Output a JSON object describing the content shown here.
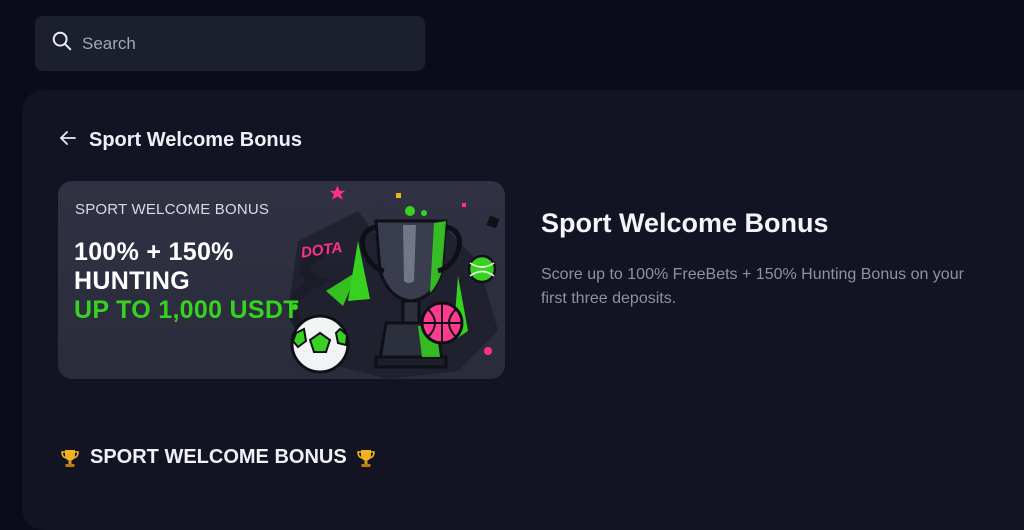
{
  "search": {
    "placeholder": "Search",
    "value": "",
    "icon": "search-icon"
  },
  "header": {
    "back_icon": "arrow-left-icon",
    "title": "Sport Welcome Bonus"
  },
  "banner": {
    "eyebrow": "SPORT WELCOME BONUS",
    "line1": "100% + 150%",
    "line2": "HUNTING",
    "line3": "UP TO 1,000 USDT",
    "sticker": "DOTA",
    "accent": "#36d21f"
  },
  "promo": {
    "title": "Sport Welcome Bonus",
    "description": "Score up to 100% FreeBets + 150% Hunting Bonus on your first three deposits."
  },
  "section": {
    "title": "SPORT WELCOME BONUS",
    "icon": "trophy-icon"
  },
  "colors": {
    "background": "#0b0c19",
    "panel": "#121423",
    "search_bg": "#1c1f2d",
    "text_primary": "#f4f5fa",
    "text_muted": "#8d91a3",
    "gold": "#f2b322",
    "pink": "#ff2f8e"
  }
}
